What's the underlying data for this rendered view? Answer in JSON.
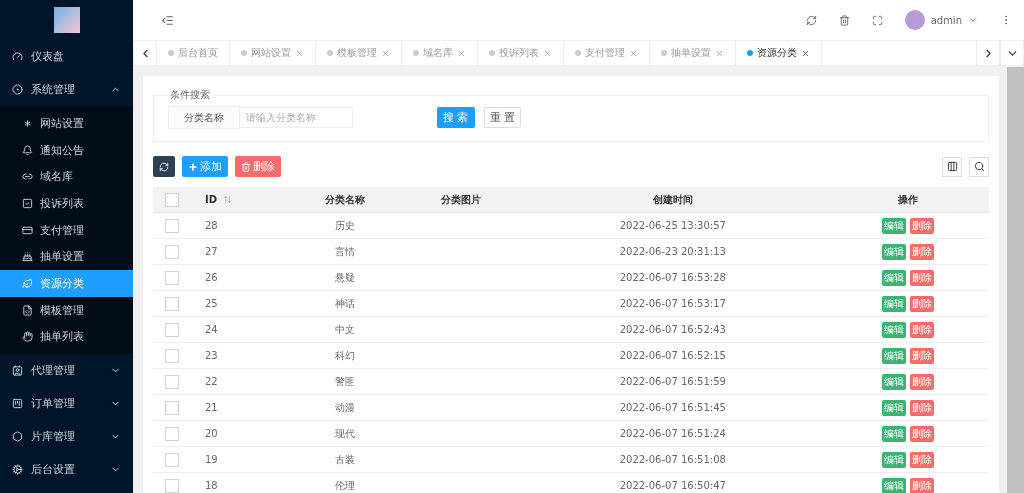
{
  "sidebar": {
    "items": [
      {
        "label": "仪表盘",
        "selected": false
      },
      {
        "label": "系统管理",
        "expanded": true,
        "selected": false,
        "children": [
          {
            "label": "网站设置",
            "selected": false
          },
          {
            "label": "通知公告",
            "selected": false
          },
          {
            "label": "域名库",
            "selected": false
          },
          {
            "label": "投诉列表",
            "selected": false
          },
          {
            "label": "支付管理",
            "selected": false
          },
          {
            "label": "抽单设置",
            "selected": false
          },
          {
            "label": "资源分类",
            "selected": true
          },
          {
            "label": "模板管理",
            "selected": false
          },
          {
            "label": "抽单列表",
            "selected": false
          }
        ]
      },
      {
        "label": "代理管理",
        "expanded": false,
        "selected": false
      },
      {
        "label": "订单管理",
        "expanded": false,
        "selected": false
      },
      {
        "label": "片库管理",
        "expanded": false,
        "selected": false
      },
      {
        "label": "后台设置",
        "expanded": false,
        "selected": false
      }
    ]
  },
  "header": {
    "user": "admin"
  },
  "tabs": [
    {
      "label": "后台首页",
      "selected": false,
      "closable": false
    },
    {
      "label": "网站设置",
      "selected": false,
      "closable": true
    },
    {
      "label": "模板管理",
      "selected": false,
      "closable": true
    },
    {
      "label": "域名库",
      "selected": false,
      "closable": true
    },
    {
      "label": "投诉列表",
      "selected": false,
      "closable": true
    },
    {
      "label": "支付管理",
      "selected": false,
      "closable": true
    },
    {
      "label": "抽单设置",
      "selected": false,
      "closable": true
    },
    {
      "label": "资源分类",
      "selected": true,
      "closable": true
    }
  ],
  "search": {
    "legend": "条件搜索",
    "field_label": "分类名称",
    "placeholder": "请输入分类名称",
    "search_button": "搜 索",
    "reset_button": "重 置"
  },
  "toolbar": {
    "add": "添加",
    "delete": "删除"
  },
  "table": {
    "columns": [
      "ID",
      "分类名称",
      "分类图片",
      "创建时间",
      "操作"
    ],
    "all_checked": false,
    "rows": [
      {
        "id": "28",
        "name": "历史",
        "created": "2022-06-25 13:30:57",
        "checked": false,
        "edit": "编辑",
        "delete": "删除"
      },
      {
        "id": "27",
        "name": "言情",
        "created": "2022-06-23 20:31:13",
        "checked": false,
        "edit": "编辑",
        "delete": "删除"
      },
      {
        "id": "26",
        "name": "悬疑",
        "created": "2022-06-07 16:53:28",
        "checked": false,
        "edit": "编辑",
        "delete": "删除"
      },
      {
        "id": "25",
        "name": "神话",
        "created": "2022-06-07 16:53:17",
        "checked": false,
        "edit": "编辑",
        "delete": "删除"
      },
      {
        "id": "24",
        "name": "中文",
        "created": "2022-06-07 16:52:43",
        "checked": false,
        "edit": "编辑",
        "delete": "删除"
      },
      {
        "id": "23",
        "name": "科幻",
        "created": "2022-06-07 16:52:15",
        "checked": false,
        "edit": "编辑",
        "delete": "删除"
      },
      {
        "id": "22",
        "name": "警匪",
        "created": "2022-06-07 16:51:59",
        "checked": false,
        "edit": "编辑",
        "delete": "删除"
      },
      {
        "id": "21",
        "name": "动漫",
        "created": "2022-06-07 16:51:45",
        "checked": false,
        "edit": "编辑",
        "delete": "删除"
      },
      {
        "id": "20",
        "name": "现代",
        "created": "2022-06-07 16:51:24",
        "checked": false,
        "edit": "编辑",
        "delete": "删除"
      },
      {
        "id": "19",
        "name": "古装",
        "created": "2022-06-07 16:51:08",
        "checked": false,
        "edit": "编辑",
        "delete": "删除"
      },
      {
        "id": "18",
        "name": "伦理",
        "created": "2022-06-07 16:50:47",
        "checked": false,
        "edit": "编辑",
        "delete": "删除"
      }
    ]
  }
}
